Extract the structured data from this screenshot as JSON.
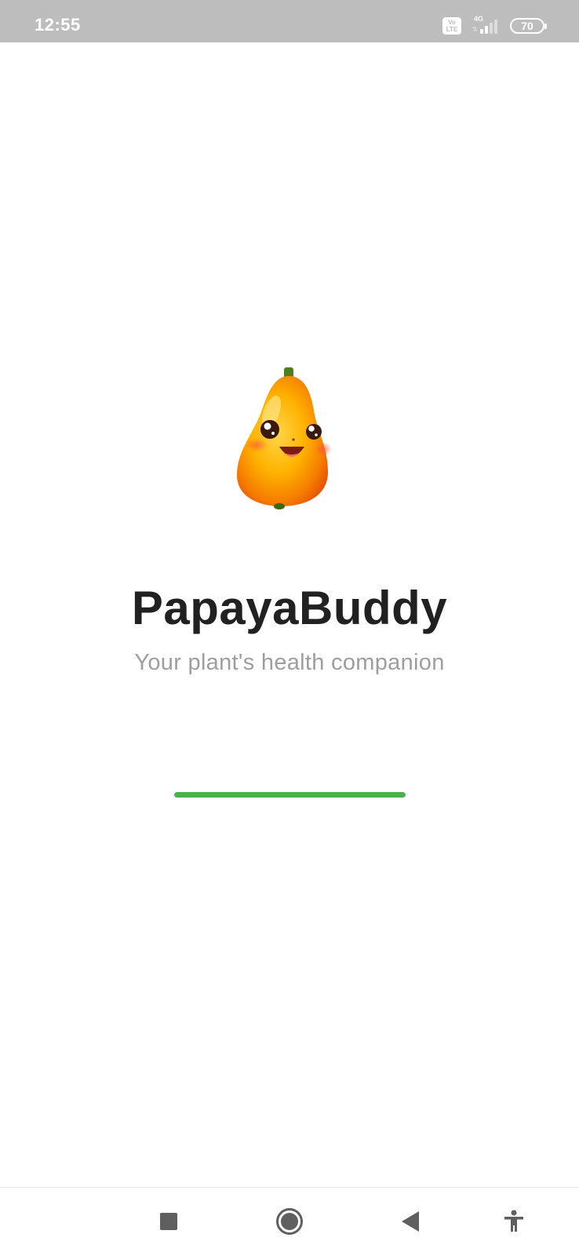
{
  "status_bar": {
    "time": "12:55",
    "volte_label": "Vo LTE",
    "network_type": "4G",
    "battery_level": "70"
  },
  "app": {
    "title": "PapayaBuddy",
    "subtitle": "Your plant's health companion",
    "logo_icon": "papaya-mascot-icon",
    "loading_progress": 1.0,
    "accent_color": "#4caf50"
  },
  "nav_bar": {
    "recents_icon": "square-recents-icon",
    "home_icon": "circle-home-icon",
    "back_icon": "triangle-back-icon",
    "accessibility_icon": "accessibility-person-icon"
  }
}
